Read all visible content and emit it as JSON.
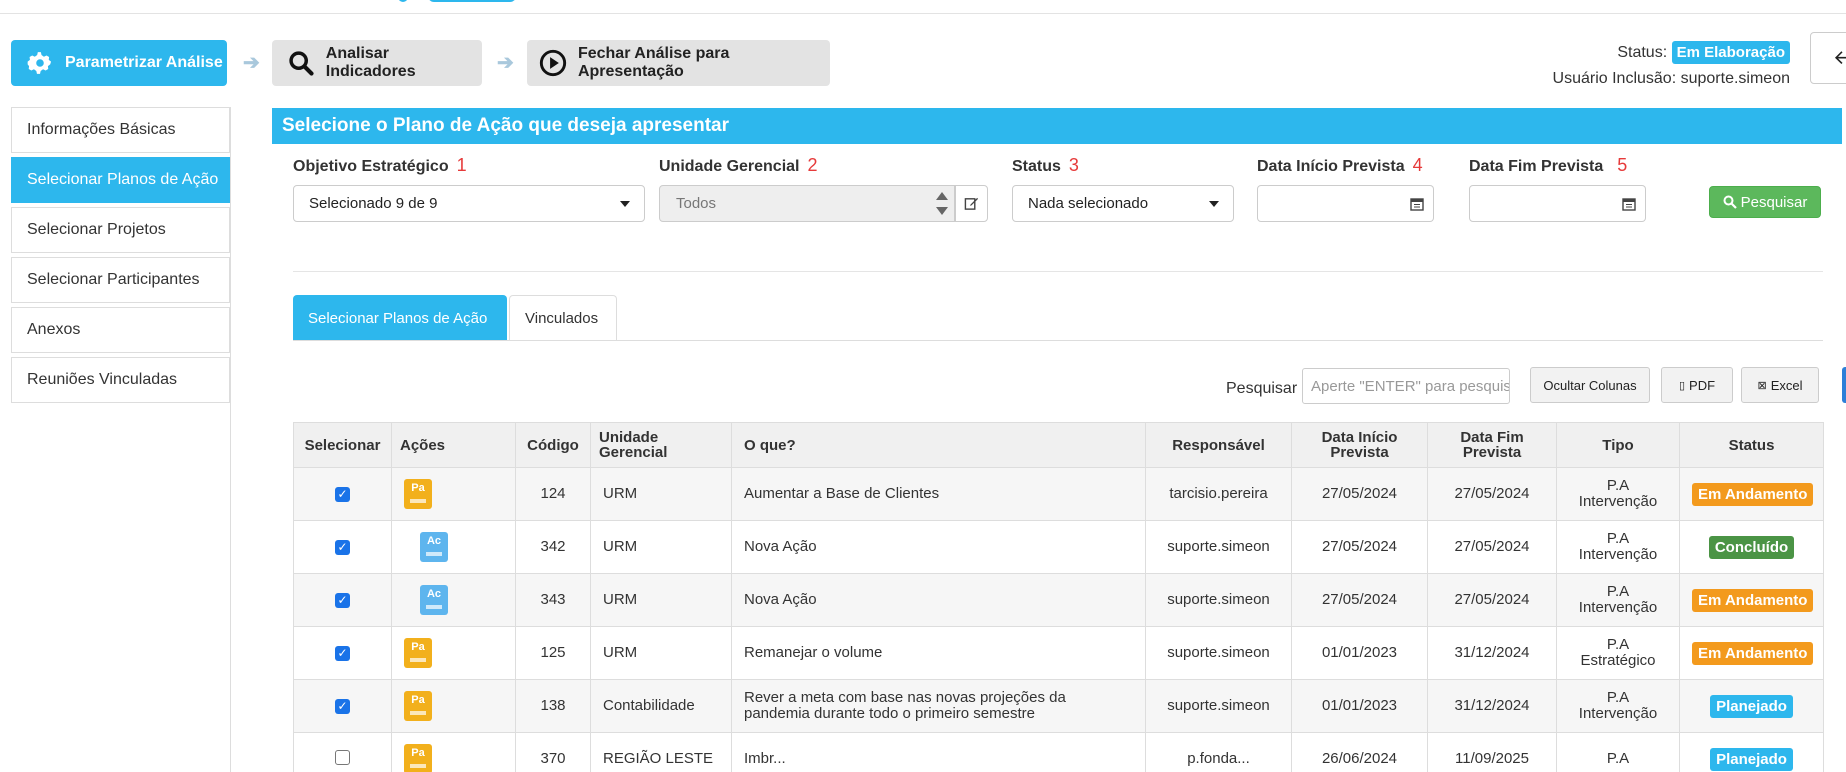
{
  "wizard": {
    "steps": [
      {
        "label": "Parametrizar Análise",
        "icon": "gear-icon",
        "active": true
      },
      {
        "label": "Analisar Indicadores",
        "icon": "search-icon",
        "active": false
      },
      {
        "label": "Fechar Análise para Apresentação",
        "icon": "play-circle-icon",
        "active": false
      }
    ]
  },
  "status": {
    "label": "Status:",
    "value": "Em Elaboração",
    "user_label": "Usuário Inclusão:",
    "user_value": "suporte.simeon"
  },
  "sidebar": {
    "items": [
      {
        "label": "Informações Básicas",
        "active": false
      },
      {
        "label": "Selecionar Planos de Ação",
        "active": true
      },
      {
        "label": "Selecionar Projetos",
        "active": false
      },
      {
        "label": "Selecionar Participantes",
        "active": false
      },
      {
        "label": "Anexos",
        "active": false
      },
      {
        "label": "Reuniões Vinculadas",
        "active": false
      }
    ]
  },
  "panel": {
    "title": "Selecione o Plano de Ação que deseja apresentar"
  },
  "filters": {
    "objetivo": {
      "label": "Objetivo Estratégico",
      "num": "1",
      "value": "Selecionado 9 de 9"
    },
    "unidade": {
      "label": "Unidade Gerencial",
      "num": "2",
      "value": "Todos"
    },
    "status": {
      "label": "Status",
      "num": "3",
      "value": "Nada selecionado"
    },
    "inicio": {
      "label": "Data Início Prevista",
      "num": "4",
      "value": ""
    },
    "fim": {
      "label": "Data Fim Prevista",
      "num": "5",
      "value": ""
    },
    "search_button": "Pesquisar"
  },
  "tabs": [
    {
      "label": "Selecionar Planos de Ação",
      "active": true
    },
    {
      "label": "Vinculados",
      "active": false
    }
  ],
  "toolbar": {
    "search_label": "Pesquisar",
    "search_placeholder": "Aperte \"ENTER\" para pesquisar",
    "hide_columns": "Ocultar Colunas",
    "pdf": "PDF",
    "excel": "Excel"
  },
  "table": {
    "headers": [
      "Selecionar",
      "Ações",
      "Código",
      "Unidade Gerencial",
      "O que?",
      "Responsável",
      "Data Início Prevista",
      "Data Fim Prevista",
      "Tipo",
      "Status"
    ],
    "rows": [
      {
        "checked": true,
        "action": "Pa",
        "codigo": "124",
        "unidade": "URM",
        "oque": "Aumentar a Base de Clientes",
        "responsavel": "tarcisio.pereira",
        "inicio": "27/05/2024",
        "fim": "27/05/2024",
        "tipo1": "P.A",
        "tipo2": "Intervenção",
        "status": "Em Andamento",
        "status_color": "#f39a1d"
      },
      {
        "checked": true,
        "action": "Ac",
        "codigo": "342",
        "unidade": "URM",
        "oque": "Nova Ação",
        "responsavel": "suporte.simeon",
        "inicio": "27/05/2024",
        "fim": "27/05/2024",
        "tipo1": "P.A",
        "tipo2": "Intervenção",
        "status": "Concluído",
        "status_color": "#4b9445"
      },
      {
        "checked": true,
        "action": "Ac",
        "codigo": "343",
        "unidade": "URM",
        "oque": "Nova Ação",
        "responsavel": "suporte.simeon",
        "inicio": "27/05/2024",
        "fim": "27/05/2024",
        "tipo1": "P.A",
        "tipo2": "Intervenção",
        "status": "Em Andamento",
        "status_color": "#f39a1d"
      },
      {
        "checked": true,
        "action": "Pa",
        "codigo": "125",
        "unidade": "URM",
        "oque": "Remanejar o volume",
        "responsavel": "suporte.simeon",
        "inicio": "01/01/2023",
        "fim": "31/12/2024",
        "tipo1": "P.A",
        "tipo2": "Estratégico",
        "status": "Em Andamento",
        "status_color": "#f39a1d"
      },
      {
        "checked": true,
        "action": "Pa",
        "codigo": "138",
        "unidade": "Contabilidade",
        "oque": "Rever a meta com base nas novas projeções da pandemia durante todo o primeiro semestre",
        "responsavel": "suporte.simeon",
        "inicio": "01/01/2023",
        "fim": "31/12/2024",
        "tipo1": "P.A",
        "tipo2": "Intervenção",
        "status": "Planejado",
        "status_color": "#2db7ed"
      },
      {
        "checked": false,
        "action": "Pa",
        "codigo": "370",
        "unidade": "REGIÃO LESTE",
        "oque": "Imbr...",
        "responsavel": "p.fonda...",
        "inicio": "26/06/2024",
        "fim": "11/09/2025",
        "tipo1": "P.A",
        "tipo2": "",
        "status": "Planejado",
        "status_color": "#2db7ed"
      }
    ]
  }
}
